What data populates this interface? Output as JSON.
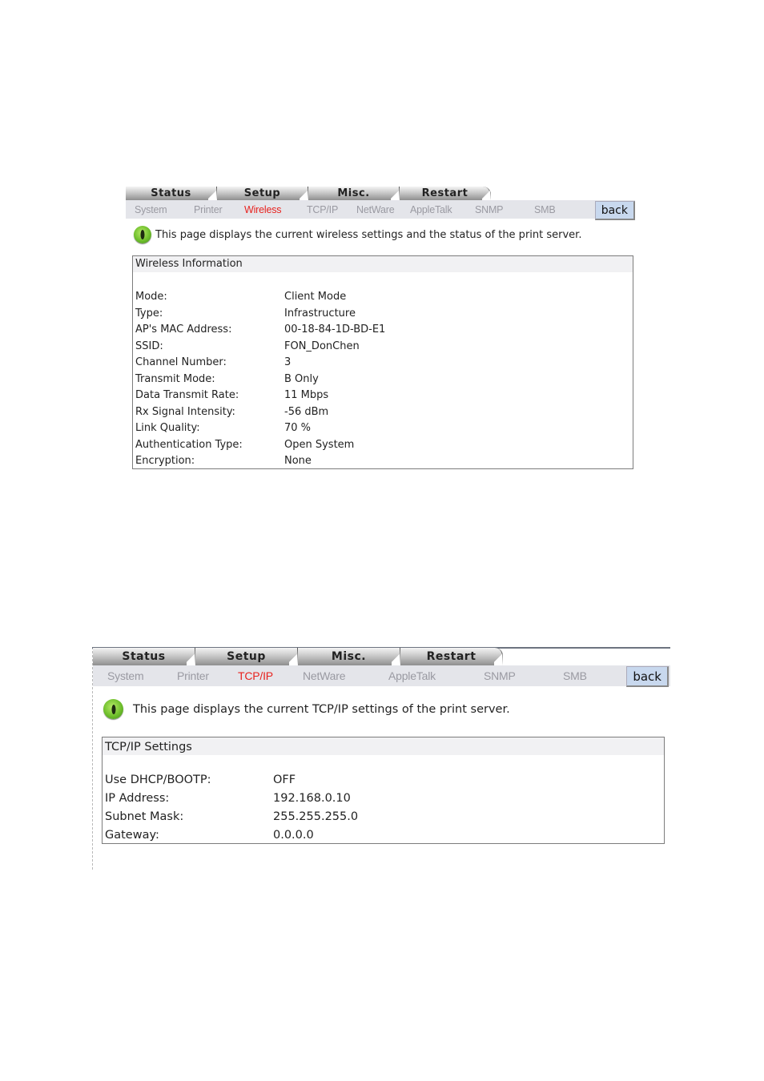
{
  "tabs": [
    "Status",
    "Setup",
    "Misc.",
    "Restart"
  ],
  "back_label": "back",
  "icons": {
    "info": "green-eye-info-icon"
  },
  "colors": {
    "active_subnav": "#e8231f",
    "inactive_subnav": "#9a9aa2",
    "subnav_bg": "#e4e5ea",
    "back_bg": "#c8d8ee"
  },
  "panel1": {
    "subnav": [
      "System",
      "Printer",
      "Wireless",
      "TCP/IP",
      "NetWare",
      "AppleTalk",
      "SNMP",
      "SMB"
    ],
    "active_subnav": "Wireless",
    "description": "This page displays the current wireless settings and the status of the print server.",
    "box_title": "Wireless Information",
    "rows": [
      {
        "label": "Mode:",
        "value": "Client Mode"
      },
      {
        "label": "Type:",
        "value": "Infrastructure"
      },
      {
        "label": "AP's MAC Address:",
        "value": "00-18-84-1D-BD-E1"
      },
      {
        "label": "SSID:",
        "value": "FON_DonChen"
      },
      {
        "label": "Channel Number:",
        "value": "3"
      },
      {
        "label": "Transmit Mode:",
        "value": "B Only"
      },
      {
        "label": "Data Transmit Rate:",
        "value": "11 Mbps"
      },
      {
        "label": "Rx Signal Intensity:",
        "value": "-56 dBm"
      },
      {
        "label": "Link Quality:",
        "value": "70 %"
      },
      {
        "label": "Authentication Type:",
        "value": "Open System"
      },
      {
        "label": "Encryption:",
        "value": "None"
      }
    ]
  },
  "panel2": {
    "subnav": [
      "System",
      "Printer",
      "TCP/IP",
      "NetWare",
      "AppleTalk",
      "SNMP",
      "SMB"
    ],
    "active_subnav": "TCP/IP",
    "description": "This page displays the current TCP/IP settings of the print server.",
    "box_title": "TCP/IP Settings",
    "rows": [
      {
        "label": "Use DHCP/BOOTP:",
        "value": "OFF"
      },
      {
        "label": "IP Address:",
        "value": "192.168.0.10"
      },
      {
        "label": "Subnet Mask:",
        "value": "255.255.255.0"
      },
      {
        "label": "Gateway:",
        "value": "0.0.0.0"
      }
    ]
  }
}
